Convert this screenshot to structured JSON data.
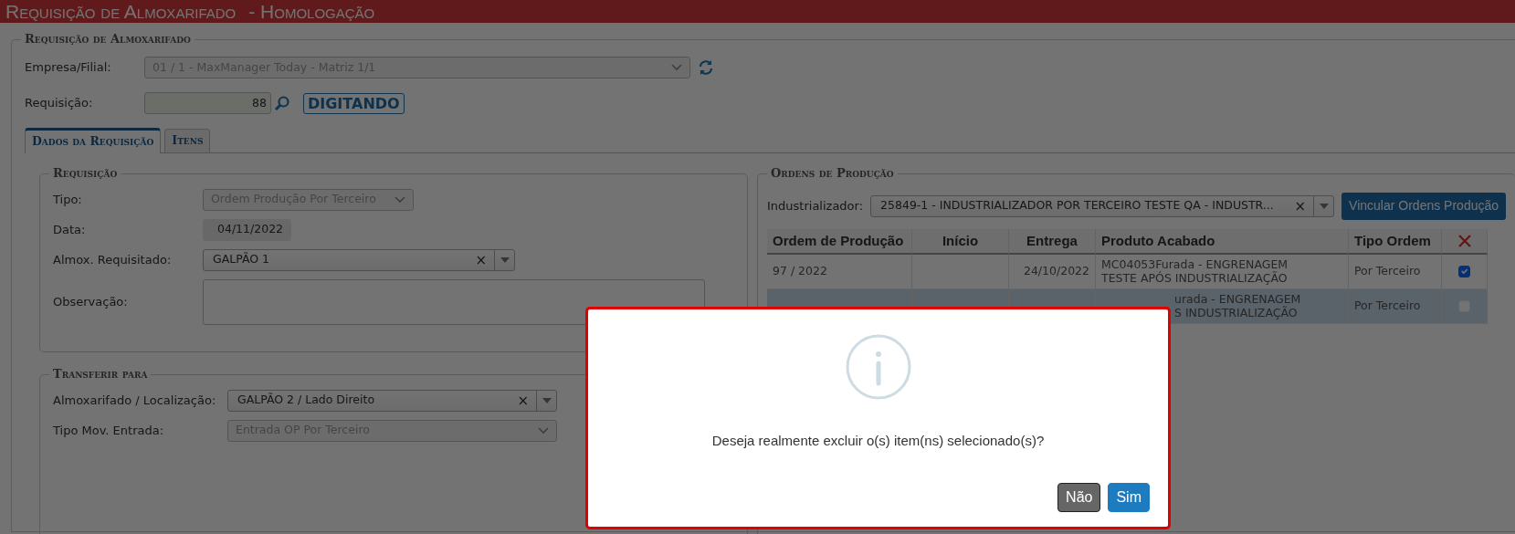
{
  "header": {
    "title": "Requisição de Almoxarifado",
    "environment": "- Homologação"
  },
  "main_section": {
    "legend": "Requisição de Almoxarifado",
    "empresa": {
      "label": "Empresa/Filial:",
      "value": "01 / 1 - MaxManager Today - Matriz 1/1",
      "disabled": true
    },
    "requisicao": {
      "label": "Requisição:",
      "value": "88"
    },
    "status_badge": "DIGITANDO"
  },
  "tabs": [
    {
      "label": "Dados da Requisição",
      "selected": true
    },
    {
      "label": "Itens",
      "selected": false
    }
  ],
  "requisicao_panel": {
    "legend": "Requisição",
    "fields": [
      {
        "kind": "select",
        "label": "Tipo:",
        "value": "Ordem Produção Por Terceiro",
        "disabled": true
      },
      {
        "kind": "date",
        "label": "Data:",
        "value": "04/11/2022"
      },
      {
        "kind": "combo",
        "label": "Almox. Requisitado:",
        "value": "GALPÃO 1",
        "clear": "×"
      },
      {
        "kind": "textarea",
        "label": "Observação:"
      }
    ]
  },
  "transferir_panel": {
    "legend": "Transferir para",
    "fields": [
      {
        "kind": "combo",
        "label": "Almoxarifado / Localização:",
        "value": "GALPÃO 2 / Lado Direito",
        "clear": "×"
      },
      {
        "kind": "select",
        "label": "Tipo Mov. Entrada:",
        "value": "Entrada OP Por Terceiro",
        "disabled": true
      }
    ]
  },
  "ordens_panel": {
    "legend": "Ordens de Produção",
    "industrializador": {
      "label": "Industrializador:",
      "value": "25849-1 - INDUSTRIALIZADOR POR TERCEIRO TESTE QA - INDUSTR...",
      "clear": "×"
    },
    "link_button": "Vincular Ordens Produção",
    "table": {
      "columns": [
        "Ordem de Produção",
        "Início",
        "Entrega",
        "Produto Acabado",
        "Tipo Ordem"
      ],
      "rows": [
        {
          "ordem": "97 / 2022",
          "entrega": "24/10/2022",
          "produto": [
            "MC04053Furada - ENGRENAGEM",
            "TESTE APÓS INDUSTRIALIZAÇÃO"
          ],
          "tipo": "Por Terceiro",
          "checked": true,
          "selected": false
        },
        {
          "produto": [
            "urada - ENGRENAGEM",
            "S INDUSTRIALIZAÇÃO"
          ],
          "tipo": "Por Terceiro",
          "checked": false,
          "selected": true
        }
      ]
    }
  },
  "dialog": {
    "message": "Deseja realmente excluir o(s) item(ns) selecionado(s)?",
    "buttons": [
      {
        "label": "Não",
        "kind": "secondary"
      },
      {
        "label": "Sim",
        "kind": "primary"
      }
    ]
  }
}
